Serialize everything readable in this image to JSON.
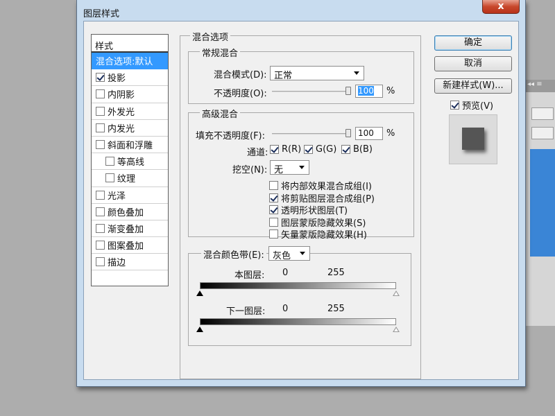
{
  "dialog": {
    "title": "图层样式",
    "close": "x"
  },
  "styles": {
    "header": "样式",
    "items": [
      {
        "label": "混合选项:默认",
        "checkbox": false,
        "checked": false,
        "selected": true,
        "sub": false
      },
      {
        "label": "投影",
        "checkbox": true,
        "checked": true,
        "selected": false,
        "sub": false
      },
      {
        "label": "内阴影",
        "checkbox": true,
        "checked": false,
        "selected": false,
        "sub": false
      },
      {
        "label": "外发光",
        "checkbox": true,
        "checked": false,
        "selected": false,
        "sub": false
      },
      {
        "label": "内发光",
        "checkbox": true,
        "checked": false,
        "selected": false,
        "sub": false
      },
      {
        "label": "斜面和浮雕",
        "checkbox": true,
        "checked": false,
        "selected": false,
        "sub": false
      },
      {
        "label": "等高线",
        "checkbox": true,
        "checked": false,
        "selected": false,
        "sub": true
      },
      {
        "label": "纹理",
        "checkbox": true,
        "checked": false,
        "selected": false,
        "sub": true
      },
      {
        "label": "光泽",
        "checkbox": true,
        "checked": false,
        "selected": false,
        "sub": false
      },
      {
        "label": "颜色叠加",
        "checkbox": true,
        "checked": false,
        "selected": false,
        "sub": false
      },
      {
        "label": "渐变叠加",
        "checkbox": true,
        "checked": false,
        "selected": false,
        "sub": false
      },
      {
        "label": "图案叠加",
        "checkbox": true,
        "checked": false,
        "selected": false,
        "sub": false
      },
      {
        "label": "描边",
        "checkbox": true,
        "checked": false,
        "selected": false,
        "sub": false
      }
    ]
  },
  "blend": {
    "title": "混合选项",
    "general": {
      "title": "常规混合",
      "mode_label": "混合模式(D):",
      "mode_value": "正常",
      "opacity_label": "不透明度(O):",
      "opacity_value": "100",
      "opacity_unit": "%",
      "opacity_fraction": 1.0
    },
    "advanced": {
      "title": "高级混合",
      "fill_label": "填充不透明度(F):",
      "fill_value": "100",
      "fill_unit": "%",
      "fill_fraction": 1.0,
      "channels_label": "通道:",
      "channels": [
        {
          "label": "R(R)",
          "checked": true
        },
        {
          "label": "G(G)",
          "checked": true
        },
        {
          "label": "B(B)",
          "checked": true
        }
      ],
      "knockout_label": "挖空(N):",
      "knockout_value": "无",
      "options": [
        {
          "label": "将内部效果混合成组(I)",
          "checked": false
        },
        {
          "label": "将剪贴图层混合成组(P)",
          "checked": true
        },
        {
          "label": "透明形状图层(T)",
          "checked": true
        },
        {
          "label": "图层蒙版隐藏效果(S)",
          "checked": false
        },
        {
          "label": "矢量蒙版隐藏效果(H)",
          "checked": false
        }
      ]
    },
    "band": {
      "label": "混合颜色带(E):",
      "value": "灰色",
      "this_layer_label": "本图层:",
      "this_layer_min": "0",
      "this_layer_max": "255",
      "underlying_label": "下一图层:",
      "underlying_min": "0",
      "underlying_max": "255"
    }
  },
  "buttons": {
    "ok": "确定",
    "cancel": "取消",
    "new_style": "新建样式(W)...",
    "preview_label": "预览(V)",
    "preview_checked": true
  },
  "icons": {
    "close": "close-icon",
    "dropdown": "chevron-down-icon",
    "slider_black": "black-point-marker-icon",
    "slider_white": "white-point-marker-icon"
  }
}
